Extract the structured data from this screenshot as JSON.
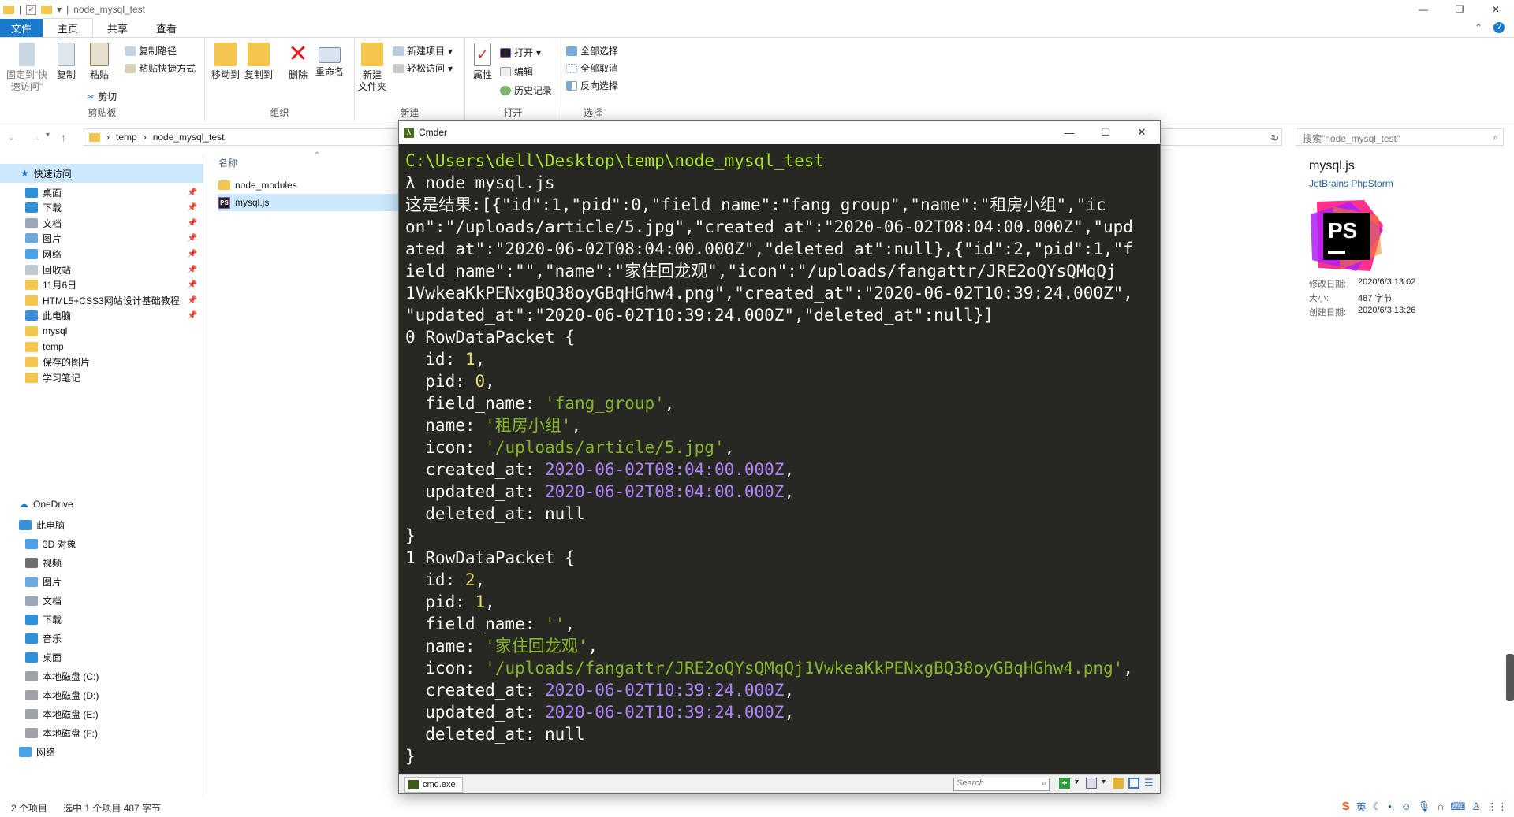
{
  "explorer": {
    "title": "node_mysql_test",
    "ribbon_tabs": [
      "文件",
      "主页",
      "共享",
      "查看"
    ],
    "ribbon": {
      "clipboard": {
        "pin": "固定到\"快速访问\"",
        "copy": "复制",
        "paste": "粘贴",
        "copy_path": "复制路径",
        "paste_shortcut": "粘贴快捷方式",
        "cut": "剪切",
        "label": "剪贴板"
      },
      "organize": {
        "move_to": "移动到",
        "copy_to": "复制到",
        "delete": "删除",
        "rename": "重命名",
        "label": "组织"
      },
      "new": {
        "new_folder": "新建\n文件夹",
        "new_item": "新建项目",
        "easy_access": "轻松访问",
        "label": "新建"
      },
      "open": {
        "properties": "属性",
        "open": "打开",
        "edit": "编辑",
        "history": "历史记录",
        "label": "打开"
      },
      "select": {
        "select_all": "全部选择",
        "select_none": "全部取消",
        "invert": "反向选择",
        "label": "选择"
      }
    },
    "breadcrumb": [
      "temp",
      "node_mysql_test"
    ],
    "search_placeholder": "搜索\"node_mysql_test\"",
    "nav_pane": {
      "quick_access": "快速访问",
      "quick_items": [
        "桌面",
        "下载",
        "文档",
        "图片",
        "网络",
        "回收站",
        "11月6日",
        "HTML5+CSS3网站设计基础教程",
        "此电脑",
        "mysql",
        "temp",
        "保存的图片",
        "学习笔记"
      ],
      "onedrive": "OneDrive",
      "this_pc": "此电脑",
      "pc_items": [
        "3D 对象",
        "视频",
        "图片",
        "文档",
        "下载",
        "音乐",
        "桌面",
        "本地磁盘 (C:)",
        "本地磁盘 (D:)",
        "本地磁盘 (E:)",
        "本地磁盘 (F:)"
      ],
      "network": "网络"
    },
    "file_list": {
      "column_name": "名称",
      "items": [
        "node_modules",
        "mysql.js"
      ]
    },
    "preview": {
      "name": "mysql.js",
      "app": "JetBrains PhpStorm",
      "logo_text": "PS",
      "modified_label": "修改日期:",
      "modified": "2020/6/3 13:02",
      "size_label": "大小:",
      "size": "487 字节",
      "created_label": "创建日期:",
      "created": "2020/6/3 13:26"
    },
    "status": {
      "count": "2 个项目",
      "selected": "选中 1 个项目 487 字节"
    },
    "tray_ime": "英"
  },
  "cmder": {
    "title": "Cmder",
    "tab": "cmd.exe",
    "search_placeholder": "Search",
    "lines": [
      "C:\\Users\\dell\\Desktop\\temp\\node_mysql_test",
      "λ node mysql.js",
      "这是结果:[{\"id\":1,\"pid\":0,\"field_name\":\"fang_group\",\"name\":\"租房小组\",\"ic",
      "on\":\"/uploads/article/5.jpg\",\"created_at\":\"2020-06-02T08:04:00.000Z\",\"upd",
      "ated_at\":\"2020-06-02T08:04:00.000Z\",\"deleted_at\":null},{\"id\":2,\"pid\":1,\"f",
      "ield_name\":\"\",\"name\":\"家住回龙观\",\"icon\":\"/uploads/fangattr/JRE2oQYsQMqQj",
      "1VwkeaKkPENxgBQ38oyGBqHGhw4.png\",\"created_at\":\"2020-06-02T10:39:24.000Z\",",
      "\"updated_at\":\"2020-06-02T10:39:24.000Z\",\"deleted_at\":null}]"
    ],
    "records": [
      {
        "index": "0",
        "type": "RowDataPacket",
        "id": "1",
        "pid": "0",
        "field_name": "'fang_group'",
        "name": "'租房小组'",
        "icon": "'/uploads/article/5.jpg'",
        "created_at": "2020-06-02T08:04:00.000Z",
        "updated_at": "2020-06-02T08:04:00.000Z",
        "deleted_at": "null"
      },
      {
        "index": "1",
        "type": "RowDataPacket",
        "id": "2",
        "pid": "1",
        "field_name": "''",
        "name": "'家住回龙观'",
        "icon": "'/uploads/fangattr/JRE2oQYsQMqQj1VwkeaKkPENxgBQ38oyGBqHGhw4.png'",
        "created_at": "2020-06-02T10:39:24.000Z",
        "updated_at": "2020-06-02T10:39:24.000Z",
        "deleted_at": "null"
      }
    ]
  },
  "colors": {
    "accent": "#1979ca",
    "console_bg": "#272822",
    "path": "#a6e22e",
    "number": "#e6db74",
    "string": "#87b52a",
    "date": "#ae81ff"
  }
}
